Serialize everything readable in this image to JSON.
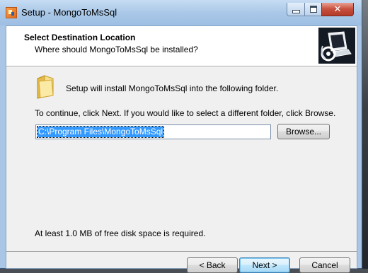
{
  "window": {
    "title": "Setup - MongoToMsSql"
  },
  "header": {
    "title": "Select Destination Location",
    "subtitle": "Where should MongoToMsSql be installed?"
  },
  "body": {
    "install_text": "Setup will install MongoToMsSql into the following folder.",
    "continue_text": "To continue, click Next. If you would like to select a different folder, click Browse.",
    "install_path": "C:\\Program Files\\MongoToMsSql",
    "disk_space_text": "At least 1.0 MB of free disk space is required."
  },
  "buttons": {
    "browse": "Browse...",
    "back": "< Back",
    "next": "Next >",
    "cancel": "Cancel"
  },
  "icons": {
    "app": "setup-app-icon",
    "logo": "installer-computer-icon",
    "folder": "folder-icon",
    "minimize": "minimize-icon",
    "maximize": "maximize-icon",
    "close": "close-icon"
  },
  "colors": {
    "selection": "#3399ff",
    "close_button": "#c74f3d",
    "titlebar": "#aac8e8"
  }
}
